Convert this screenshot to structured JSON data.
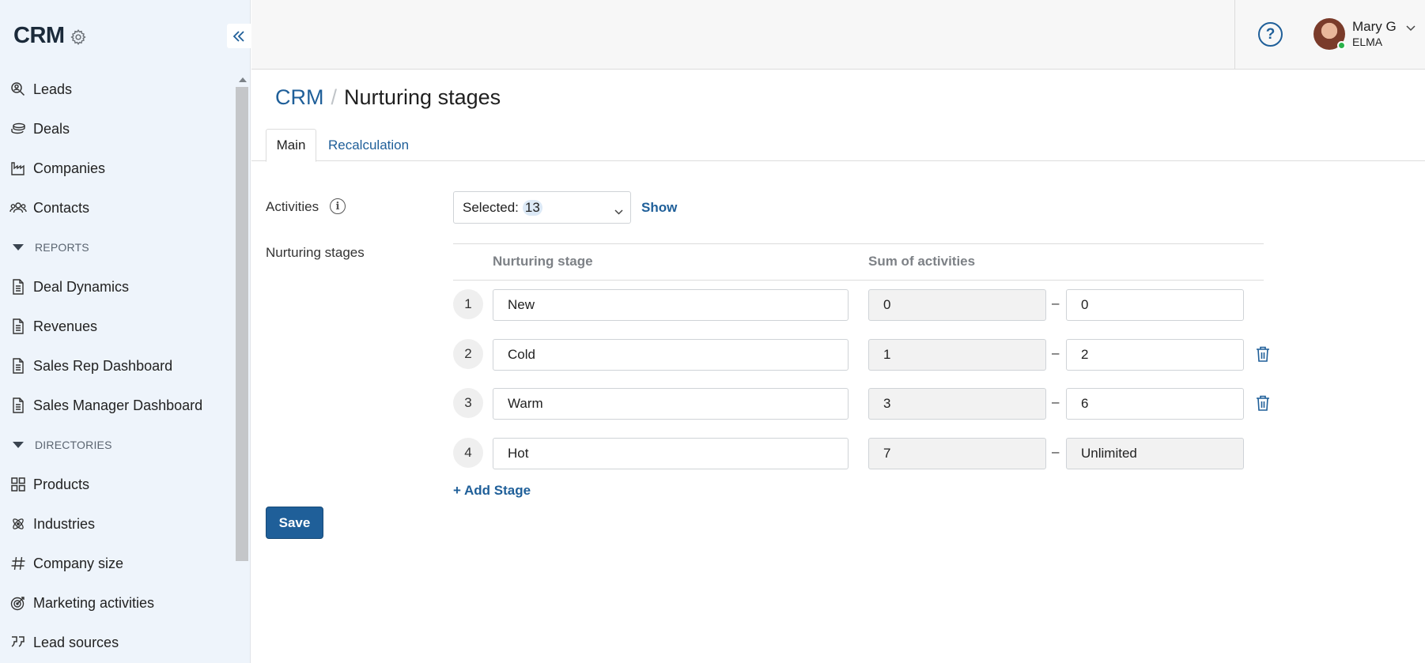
{
  "sidebar": {
    "title": "CRM",
    "items": [
      {
        "label": "Leads",
        "icon": "search-person-icon"
      },
      {
        "label": "Deals",
        "icon": "coins-icon"
      },
      {
        "label": "Companies",
        "icon": "factory-icon"
      },
      {
        "label": "Contacts",
        "icon": "people-icon"
      }
    ],
    "reports_label": "REPORTS",
    "reports": [
      {
        "label": "Deal Dynamics",
        "icon": "document-icon"
      },
      {
        "label": "Revenues",
        "icon": "document-icon"
      },
      {
        "label": "Sales Rep Dashboard",
        "icon": "document-icon"
      },
      {
        "label": "Sales Manager Dashboard",
        "icon": "document-icon"
      }
    ],
    "directories_label": "DIRECTORIES",
    "directories": [
      {
        "label": "Products",
        "icon": "grid-icon"
      },
      {
        "label": "Industries",
        "icon": "atom-icon"
      },
      {
        "label": "Company size",
        "icon": "hash-icon"
      },
      {
        "label": "Marketing activities",
        "icon": "target-icon"
      },
      {
        "label": "Lead sources",
        "icon": "quote-icon"
      }
    ]
  },
  "header": {
    "user_name": "Mary G",
    "user_org": "ELMA",
    "help_label": "?"
  },
  "breadcrumb": {
    "root": "CRM",
    "separator": "/",
    "current": "Nurturing stages"
  },
  "tabs": [
    {
      "label": "Main",
      "active": true
    },
    {
      "label": "Recalculation",
      "active": false
    }
  ],
  "form": {
    "activities_label": "Activities",
    "selected_prefix": "Selected:",
    "selected_count": "13",
    "show_label": "Show",
    "stages_label": "Nurturing stages",
    "col_stage": "Nurturing stage",
    "col_sum": "Sum of activities",
    "dash": "–",
    "stages": [
      {
        "num": "1",
        "name": "New",
        "from": "0",
        "to": "0",
        "deletable": false
      },
      {
        "num": "2",
        "name": "Cold",
        "from": "1",
        "to": "2",
        "deletable": true
      },
      {
        "num": "3",
        "name": "Warm",
        "from": "3",
        "to": "6",
        "deletable": true
      },
      {
        "num": "4",
        "name": "Hot",
        "from": "7",
        "to": "Unlimited",
        "deletable": false
      }
    ],
    "add_stage_label": "+ Add Stage",
    "save_label": "Save"
  },
  "colors": {
    "accent": "#1f5f99",
    "sidebar_bg": "#eef4fb",
    "status_online": "#2bb34b"
  }
}
